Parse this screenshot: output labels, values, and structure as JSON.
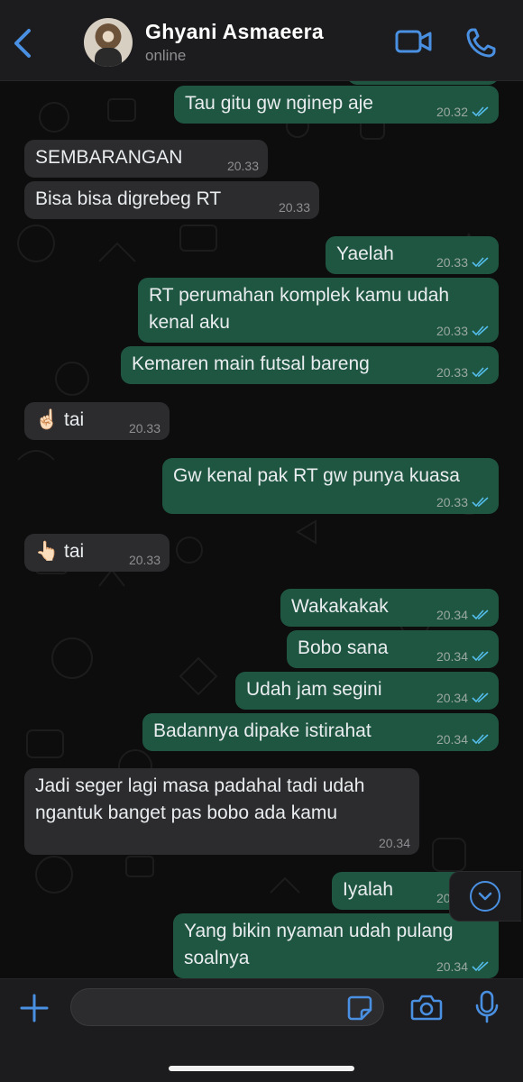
{
  "header": {
    "contact_name": "Ghyani Asmaeera",
    "status": "online",
    "back_icon": "chevron-left-icon",
    "video_icon": "video-camera-icon",
    "call_icon": "phone-icon"
  },
  "colors": {
    "accent": "#4a90e2",
    "outgoing_bubble": "#1f5641",
    "incoming_bubble": "#2c2c2e",
    "read_ticks": "#53bdeb"
  },
  "messages": [
    {
      "dir": "out",
      "text": "Tau gitu gw nginep aje",
      "time": "20.32",
      "read": true
    },
    {
      "dir": "in",
      "text": "SEMBARANGAN",
      "time": "20.33"
    },
    {
      "dir": "in",
      "text": "Bisa bisa digrebeg RT",
      "time": "20.33"
    },
    {
      "dir": "out",
      "text": "Yaelah",
      "time": "20.33",
      "read": true
    },
    {
      "dir": "out",
      "text": "RT perumahan komplek kamu udah\nkenal aku",
      "time": "20.33",
      "read": true
    },
    {
      "dir": "out",
      "text": "Kemaren main futsal bareng",
      "time": "20.33",
      "read": true
    },
    {
      "dir": "in",
      "text": "☝🏻 tai",
      "time": "20.33"
    },
    {
      "dir": "out",
      "text": "Gw kenal pak RT gw punya kuasa",
      "time": "20.33",
      "read": true
    },
    {
      "dir": "in",
      "text": "👆🏻 tai",
      "time": "20.33"
    },
    {
      "dir": "out",
      "text": "Wakakakak",
      "time": "20.34",
      "read": true
    },
    {
      "dir": "out",
      "text": "Bobo sana",
      "time": "20.34",
      "read": true
    },
    {
      "dir": "out",
      "text": "Udah jam segini",
      "time": "20.34",
      "read": true
    },
    {
      "dir": "out",
      "text": "Badannya dipake istirahat",
      "time": "20.34",
      "read": true
    },
    {
      "dir": "in",
      "text": "Jadi seger lagi masa padahal tadi udah\nngantuk banget pas bobo ada kamu",
      "time": "20.34"
    },
    {
      "dir": "out",
      "text": "Iyalah",
      "time": "20.34",
      "read": true
    },
    {
      "dir": "out",
      "text": "Yang bikin nyaman udah pulang\nsoalnya",
      "time": "20.34",
      "read": true
    }
  ],
  "composer": {
    "input_value": "",
    "plus_icon": "plus-icon",
    "sticker_icon": "sticker-icon",
    "camera_icon": "camera-icon",
    "mic_icon": "microphone-icon",
    "scroll_icon": "chevron-down-icon"
  }
}
